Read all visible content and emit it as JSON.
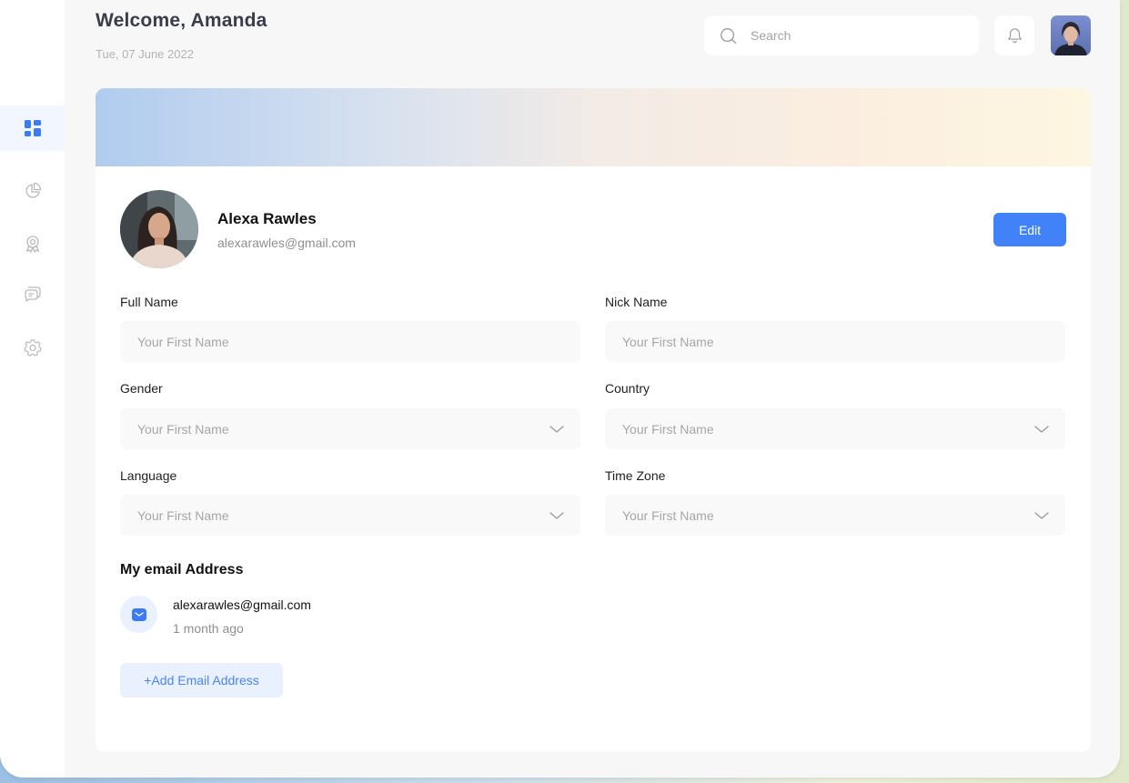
{
  "header": {
    "welcome": "Welcome, Amanda",
    "date": "Tue, 07 June 2022"
  },
  "search": {
    "placeholder": "Search",
    "value": ""
  },
  "sidebar": {
    "items": [
      {
        "icon": "dashboard-icon",
        "active": true
      },
      {
        "icon": "pie-chart-icon",
        "active": false
      },
      {
        "icon": "award-icon",
        "active": false
      },
      {
        "icon": "chat-icon",
        "active": false
      },
      {
        "icon": "gear-icon",
        "active": false
      }
    ]
  },
  "profile": {
    "name": "Alexa Rawles",
    "email": "alexarawles@gmail.com",
    "edit_label": "Edit"
  },
  "form": {
    "full_name": {
      "label": "Full Name",
      "placeholder": "Your First Name"
    },
    "nick_name": {
      "label": "Nick Name",
      "placeholder": "Your First Name"
    },
    "gender": {
      "label": "Gender",
      "placeholder": "Your First Name"
    },
    "country": {
      "label": "Country",
      "placeholder": "Your First Name"
    },
    "language": {
      "label": "Language",
      "placeholder": "Your First Name"
    },
    "time_zone": {
      "label": "Time Zone",
      "placeholder": "Your First Name"
    }
  },
  "emails": {
    "title": "My email Address",
    "items": [
      {
        "address": "alexarawles@gmail.com",
        "time": "1 month ago"
      }
    ],
    "add_label": "+Add Email Address"
  },
  "colors": {
    "accent": "#4182f9",
    "accent_light": "#eaf1fe",
    "background": "#f7f7f7"
  }
}
